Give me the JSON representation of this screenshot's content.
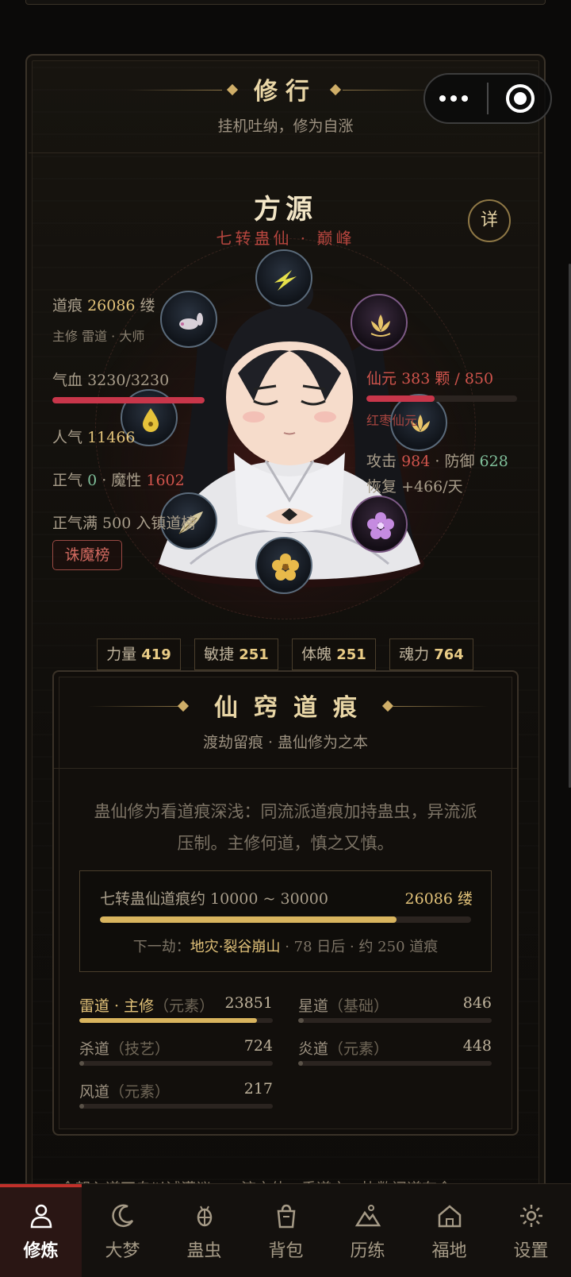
{
  "header": {
    "title": "修行",
    "subtitle": "挂机吐纳，修为自涨"
  },
  "character": {
    "name": "方源",
    "realm": "七转蛊仙 · 巅峰",
    "detail_label": "详"
  },
  "left_stats": {
    "dao_mark_label": "道痕",
    "dao_mark_value": "26086",
    "dao_mark_unit": "缕",
    "main_path": "主修 雷道 · 大师",
    "hp_label": "气血",
    "hp_value": "3230/3230",
    "hp_ratio": 1.0,
    "popularity_label": "人气",
    "popularity_value": "11466",
    "righteous_label": "正气",
    "righteous_value": "0",
    "sep": "·",
    "demonic_label": "魔性",
    "demonic_value": "1602",
    "righteous_hint": "正气满 500 入镇道榜",
    "rank_tag": "诛魔榜"
  },
  "right_stats": {
    "essence_label": "仙元",
    "essence_value": "383",
    "essence_unit": "颗 /",
    "essence_max": "850",
    "essence_ratio": 0.45,
    "essence_type": "红枣仙元",
    "attack_label": "攻击",
    "attack_value": "984",
    "defense_label": "· 防御",
    "defense_value": "628",
    "recover_label": "恢复",
    "recover_value": "+466/天"
  },
  "attributes": [
    {
      "label": "力量",
      "value": "419"
    },
    {
      "label": "敏捷",
      "value": "251"
    },
    {
      "label": "体魄",
      "value": "251"
    },
    {
      "label": "魂力",
      "value": "764"
    }
  ],
  "dao_section": {
    "title": "仙窍道痕",
    "subtitle": "渡劫留痕 · 蛊仙修为之本",
    "desc_line1": "蛊仙修为看道痕深浅：同流派道痕加持蛊虫，异流派",
    "desc_line2": "压制。主修何道，慎之又慎。",
    "range_label": "七转蛊仙道痕约 10000 ~ 30000",
    "range_value": "26086 缕",
    "range_ratio": 0.8,
    "next_prefix": "下一劫：",
    "next_name": "地灾·裂谷崩山",
    "next_suffix": "· 78 日后 · 约 250 道痕",
    "paths": [
      {
        "name": "雷道 · 主修",
        "note": "（元素）",
        "value": "23851",
        "ratio": 0.92,
        "primary": true
      },
      {
        "name": "星道",
        "note": "（基础）",
        "value": "846",
        "ratio": 0.03,
        "primary": false
      },
      {
        "name": "杀道",
        "note": "（技艺）",
        "value": "724",
        "ratio": 0.025,
        "primary": false
      },
      {
        "name": "炎道",
        "note": "（元素）",
        "value": "448",
        "ratio": 0.015,
        "primary": false
      },
      {
        "name": "风道",
        "note": "（元素）",
        "value": "217",
        "ratio": 0.008,
        "primary": false
      }
    ]
  },
  "peek_text": "今朝入道不自以诚满议，一流之体，乘道之，协数问道存食",
  "nav": [
    {
      "label": "修炼",
      "icon": "person-icon",
      "active": true
    },
    {
      "label": "大梦",
      "icon": "moon-icon",
      "active": false
    },
    {
      "label": "蛊虫",
      "icon": "bug-icon",
      "active": false
    },
    {
      "label": "背包",
      "icon": "bag-icon",
      "active": false
    },
    {
      "label": "历练",
      "icon": "mountain-icon",
      "active": false
    },
    {
      "label": "福地",
      "icon": "home-icon",
      "active": false
    },
    {
      "label": "设置",
      "icon": "gear-icon",
      "active": false
    }
  ],
  "colors": {
    "gold": "#e3c37a",
    "red": "#d0544c",
    "green": "#7fbf9a",
    "hp_bar": "#c8364a",
    "dao_bar": "#d8b45e"
  }
}
